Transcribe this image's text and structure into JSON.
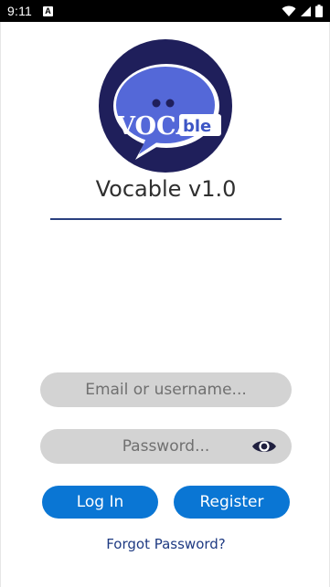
{
  "status_bar": {
    "time": "9:11",
    "notification_icon": "A",
    "icons": [
      "wifi-icon",
      "signal-icon",
      "battery-icon"
    ]
  },
  "logo": {
    "text_main": "VOCA",
    "text_suffix": "ble",
    "bg_color": "#1f1f5b",
    "bubble_color": "#5468d8"
  },
  "app": {
    "title": "Vocable v1.0"
  },
  "login_form": {
    "email_placeholder": "Email or username...",
    "password_placeholder": "Password...",
    "password_toggle_icon": "eye-icon",
    "login_label": "Log In",
    "register_label": "Register",
    "forgot_label": "Forgot Password?"
  },
  "colors": {
    "accent": "#0a76d4",
    "link": "#1e3a82",
    "field_bg": "#d3d3d3"
  }
}
